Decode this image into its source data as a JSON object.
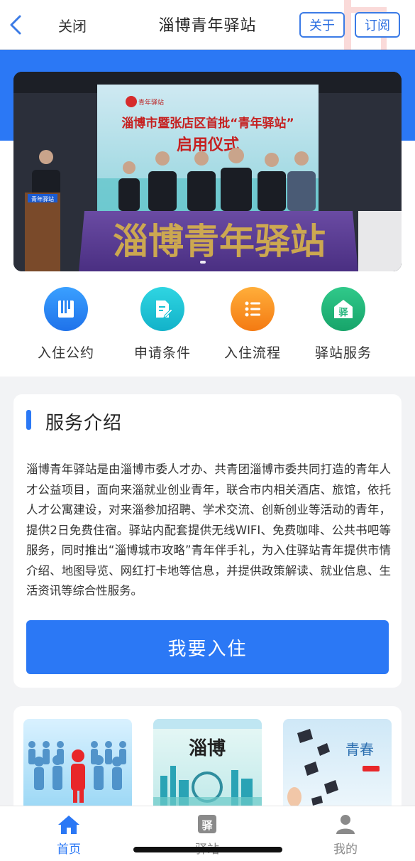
{
  "header": {
    "close_label": "关闭",
    "title": "淄博青年驿站",
    "about_label": "关于",
    "subscribe_label": "订阅"
  },
  "banner": {
    "screen_subtitle": "淄博市暨张店区首批“青年驿站”",
    "screen_title": "启用仪式",
    "screen_logo_text": "青年驿站",
    "podium_sign": "青年驿站",
    "table_banner": "淄博青年驿站"
  },
  "quick_actions": [
    {
      "label": "入住公约",
      "icon": "book-icon",
      "color": "#2b86f3"
    },
    {
      "label": "申请条件",
      "icon": "edit-document-icon",
      "color": "#14c2d4"
    },
    {
      "label": "入住流程",
      "icon": "list-icon",
      "color": "#fa8e1e"
    },
    {
      "label": "驿站服务",
      "icon": "station-icon",
      "icon_text": "驿",
      "color": "#21b57a"
    }
  ],
  "service": {
    "heading": "服务介绍",
    "description": "淄博青年驿站是由淄博市委人才办、共青团淄博市委共同打造的青年人才公益项目，面向来淄就业创业青年，联合市内相关酒店、旅馆，依托人才公寓建设，对来淄参加招聘、学术交流、创新创业等活动的青年，提供2日免费住宿。驿站内配套提供无线WIFI、免费咖啡、公共书吧等服务，同时推出“淄博城市攻略”青年伴手礼，为入住驿站青年提供市情介绍、地图导览、网红打卡地等信息，并提供政策解读、就业信息、生活资讯等综合性服务。",
    "button_label": "我要入住"
  },
  "thumbnails": [
    {
      "name": "talent-figures",
      "text": ""
    },
    {
      "name": "zibo-city",
      "text": "淄博"
    },
    {
      "name": "youth-dream",
      "text": "青春"
    }
  ],
  "tabbar": {
    "tabs": [
      {
        "label": "首页",
        "icon": "home-icon",
        "icon_text": ""
      },
      {
        "label": "驿站",
        "icon": "station-icon",
        "icon_text": "驿"
      },
      {
        "label": "我的",
        "icon": "user-icon",
        "icon_text": ""
      }
    ]
  },
  "colors": {
    "primary": "#2b78f5",
    "header_border": "#e2e2e2",
    "background": "#f2f3f5"
  }
}
